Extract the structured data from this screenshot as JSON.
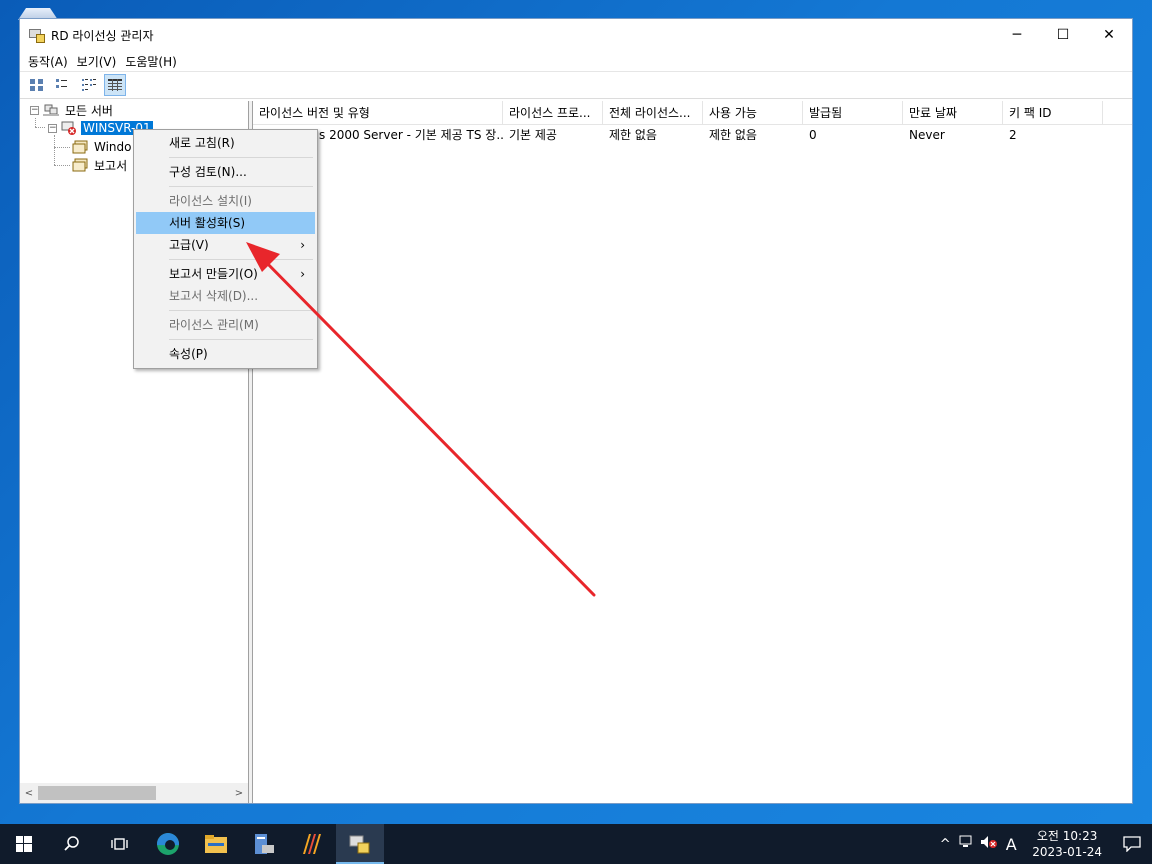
{
  "window": {
    "title": "RD 라이선싱 관리자",
    "controls": {
      "minimize": "─",
      "maximize": "☐",
      "close": "✕"
    }
  },
  "menubar": [
    "동작(A)",
    "보기(V)",
    "도움말(H)"
  ],
  "toolbar": {
    "buttons": [
      "large-icons-view",
      "small-icons-view",
      "list-view",
      "detail-view"
    ],
    "active": "detail-view"
  },
  "tree": {
    "root": "모든 서버",
    "server": "WINSVR-01",
    "children": [
      "Windo",
      "보고서"
    ]
  },
  "list": {
    "columns": [
      "라이선스 버전 및 유형",
      "라이선스 프로...",
      "전체 라이선스...",
      "사용 가능",
      "발급됨",
      "만료 날짜",
      "키 팩 ID"
    ],
    "rows": [
      [
        "s 2000 Server - 기본 제공 TS 장...",
        "기본 제공",
        "제한 없음",
        "제한 없음",
        "0",
        "Never",
        "2"
      ]
    ]
  },
  "context_menu": {
    "items": [
      {
        "label": "새로 고침(R)",
        "disabled": false
      },
      {
        "label": "구성 검토(N)...",
        "disabled": false
      },
      {
        "label": "라이선스 설치(I)",
        "disabled": true
      },
      {
        "label": "서버 활성화(S)",
        "disabled": false,
        "highlighted": true
      },
      {
        "label": "고급(V)",
        "disabled": false,
        "submenu": true
      },
      {
        "label": "보고서 만들기(O)",
        "disabled": false,
        "submenu": true
      },
      {
        "label": "보고서 삭제(D)...",
        "disabled": true
      },
      {
        "label": "라이선스 관리(M)",
        "disabled": true
      },
      {
        "label": "속성(P)",
        "disabled": false
      }
    ],
    "submenu_glyph": "›"
  },
  "taskbar": {
    "apps": [
      "start",
      "search",
      "task-view",
      "edge",
      "file-explorer",
      "server-manager",
      "app-stripes",
      "rd-licensing-manager"
    ],
    "active_app": "rd-licensing-manager"
  },
  "tray": {
    "chevron": "^",
    "ime": "A",
    "time": "오전 10:23",
    "date": "2023-01-24"
  },
  "colors": {
    "selection": "#0078d7",
    "menu_highlight": "#91c9f7",
    "annotation_arrow": "#e8262b",
    "taskbar": "#101b2b"
  }
}
